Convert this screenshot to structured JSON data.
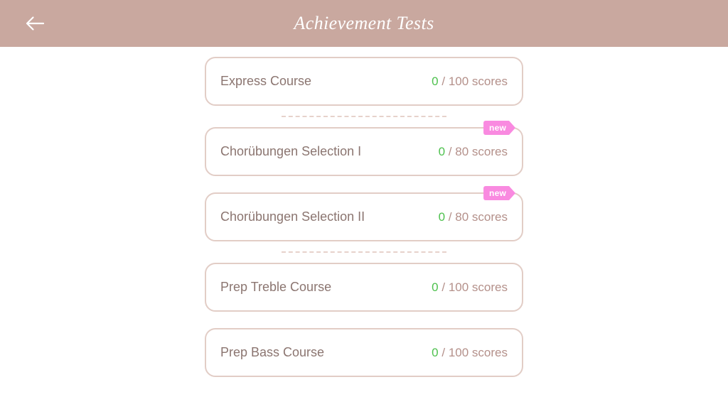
{
  "header": {
    "back_icon": "arrow-left-icon",
    "title": "Achievement Tests",
    "background_color": "#c9a89f",
    "title_color": "#ffffff"
  },
  "colors": {
    "card_border": "#e2cdc6",
    "label_text": "#8b7570",
    "score_muted": "#b4908a",
    "score_current": "#4ec14e",
    "badge_background": "#f98ae0",
    "badge_text": "#ffffff",
    "divider": "#e7d2cb",
    "page_background": "#ffffff"
  },
  "main": {
    "groups": [
      {
        "id": "group-1",
        "items": [
          {
            "label": "Express Course",
            "score_current": "0",
            "score_separator": "/",
            "score_total": "100",
            "score_unit": "scores",
            "badge": null
          }
        ]
      },
      {
        "id": "group-2",
        "items": [
          {
            "label": "Chorübungen Selection I",
            "score_current": "0",
            "score_separator": "/",
            "score_total": "80",
            "score_unit": "scores",
            "badge": "new"
          },
          {
            "label": "Chorübungen Selection II",
            "score_current": "0",
            "score_separator": "/",
            "score_total": "80",
            "score_unit": "scores",
            "badge": "new"
          }
        ]
      },
      {
        "id": "group-3",
        "items": [
          {
            "label": "Prep Treble Course",
            "score_current": "0",
            "score_separator": "/",
            "score_total": "100",
            "score_unit": "scores",
            "badge": null
          },
          {
            "label": "Prep Bass Course",
            "score_current": "0",
            "score_separator": "/",
            "score_total": "100",
            "score_unit": "scores",
            "badge": null
          }
        ]
      }
    ]
  }
}
